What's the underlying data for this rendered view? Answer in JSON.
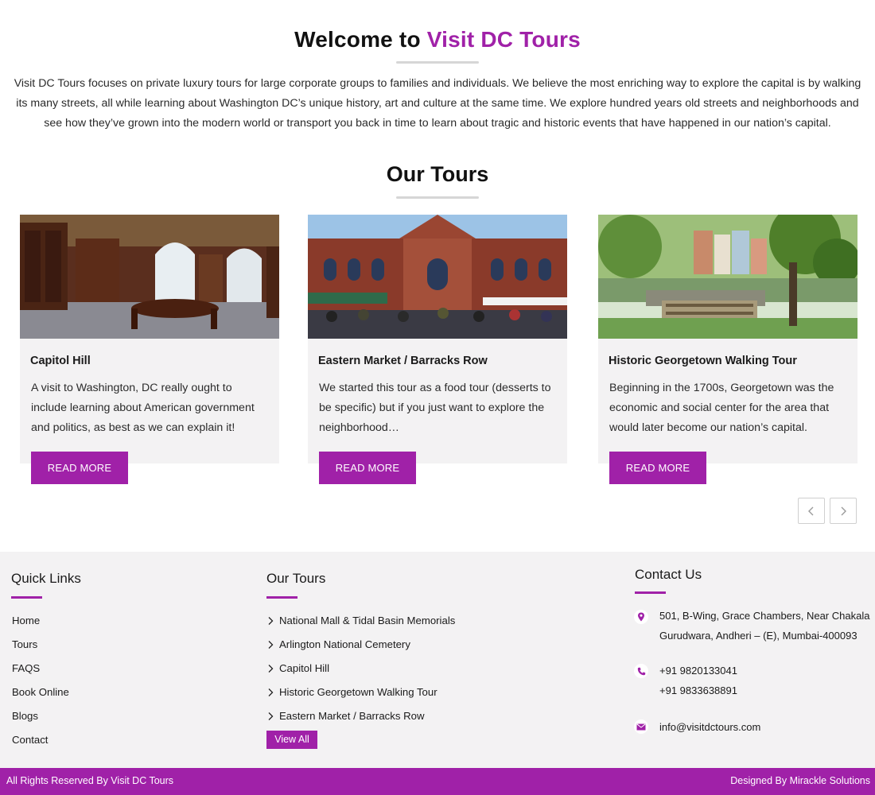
{
  "intro": {
    "welcome_prefix": "Welcome to",
    "welcome_brand": "Visit DC Tours",
    "paragraph": "Visit DC Tours focuses on private luxury tours for large corporate groups to families and individuals. We believe the most enriching way to explore the capital is by walking its many streets, all while learning about Washington DC’s unique history, art and culture at the same time. We explore hundred years old streets and neighborhoods and see how they’ve grown into the modern world or transport you back in time to learn about tragic and historic events that have happened in our nation’s capital."
  },
  "tours": {
    "title": "Our Tours",
    "cards": [
      {
        "title": "Capitol Hill",
        "description": "A visit to Washington, DC really ought to include learning about American government and politics, as best as we can explain it!",
        "button": "READ MORE",
        "image": "library-interior-photo"
      },
      {
        "title": "Eastern Market / Barracks Row",
        "description": "We started this tour as a food tour (desserts to be specific) but if you just want to explore the neighborhood…",
        "button": "READ MORE",
        "image": "market-building-photo"
      },
      {
        "title": "Historic Georgetown Walking Tour",
        "description": "Beginning in the 1700s, Georgetown was the economic and social center for the area that would later become our nation’s capital.",
        "button": "READ MORE",
        "image": "canal-street-photo"
      }
    ],
    "prev_icon": "chevron-left-icon",
    "next_icon": "chevron-right-icon"
  },
  "footer": {
    "quick_links": {
      "title": "Quick Links",
      "items": [
        "Home",
        "Tours",
        "FAQS",
        "Book Online",
        "Blogs",
        "Contact"
      ]
    },
    "our_tours": {
      "title": "Our Tours",
      "items": [
        "National Mall & Tidal Basin Memorials",
        "Arlington National Cemetery",
        "Capitol Hill",
        "Historic Georgetown Walking Tour",
        "Eastern Market / Barracks Row"
      ],
      "view_all": "View All"
    },
    "contact": {
      "title": "Contact Us",
      "address_line1": "501, B-Wing, Grace Chambers, Near Chakala",
      "address_line2": "Gurudwara, Andheri – (E), Mumbai-400093",
      "phone1": "+91 9820133041",
      "phone2": "+91 9833638891",
      "email": "info@visitdctours.com"
    }
  },
  "bottom": {
    "copyright": "All Rights Reserved By Visit DC Tours",
    "credit": "Designed By Mirackle Solutions"
  },
  "colors": {
    "accent": "#a021a8",
    "footer_bg": "#f3f2f3",
    "card_bg": "#f3f2f3"
  }
}
